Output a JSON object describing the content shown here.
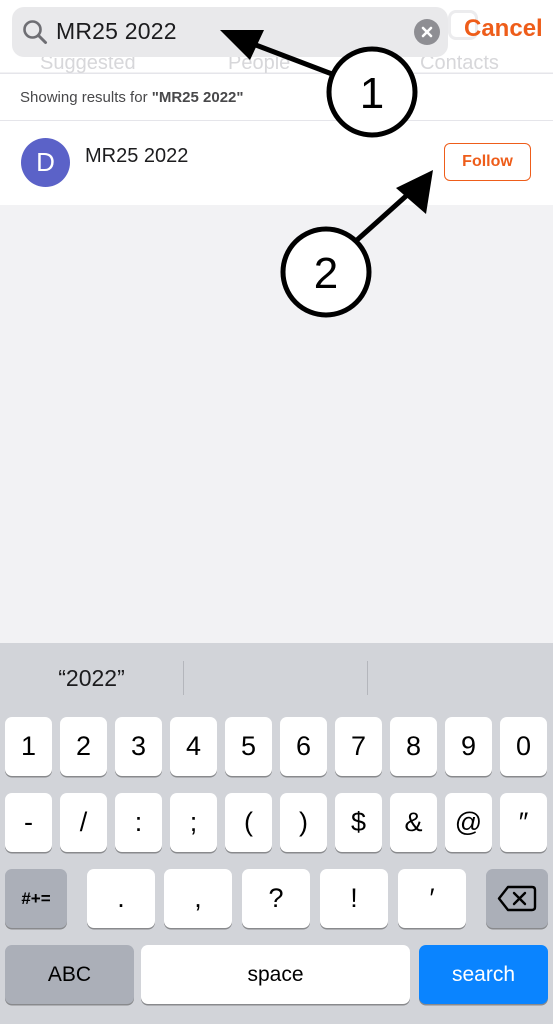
{
  "search": {
    "value": "MR25 2022",
    "cancel_label": "Cancel"
  },
  "background_tabs": [
    "Suggested",
    "People",
    "Contacts"
  ],
  "results": {
    "label_prefix": "Showing results for ",
    "query_quoted": "\"MR25 2022\"",
    "items": [
      {
        "avatar_letter": "D",
        "name": "MR25 2022",
        "follow_label": "Follow"
      }
    ]
  },
  "annotations": [
    "1",
    "2"
  ],
  "keyboard": {
    "suggestions": [
      "“2022”",
      "",
      ""
    ],
    "row1": [
      "1",
      "2",
      "3",
      "4",
      "5",
      "6",
      "7",
      "8",
      "9",
      "0"
    ],
    "row2": [
      "-",
      "/",
      ":",
      ";",
      "(",
      ")",
      "$",
      "&",
      "@",
      "″"
    ],
    "row3": [
      ".",
      ",",
      "?",
      "!",
      "′"
    ],
    "more_symbols_label": "#+=",
    "abc_label": "ABC",
    "space_label": "space",
    "search_label": "search"
  },
  "colors": {
    "accent": "#ee5d1a",
    "avatar": "#5b62c8",
    "search_key": "#0a84ff"
  }
}
